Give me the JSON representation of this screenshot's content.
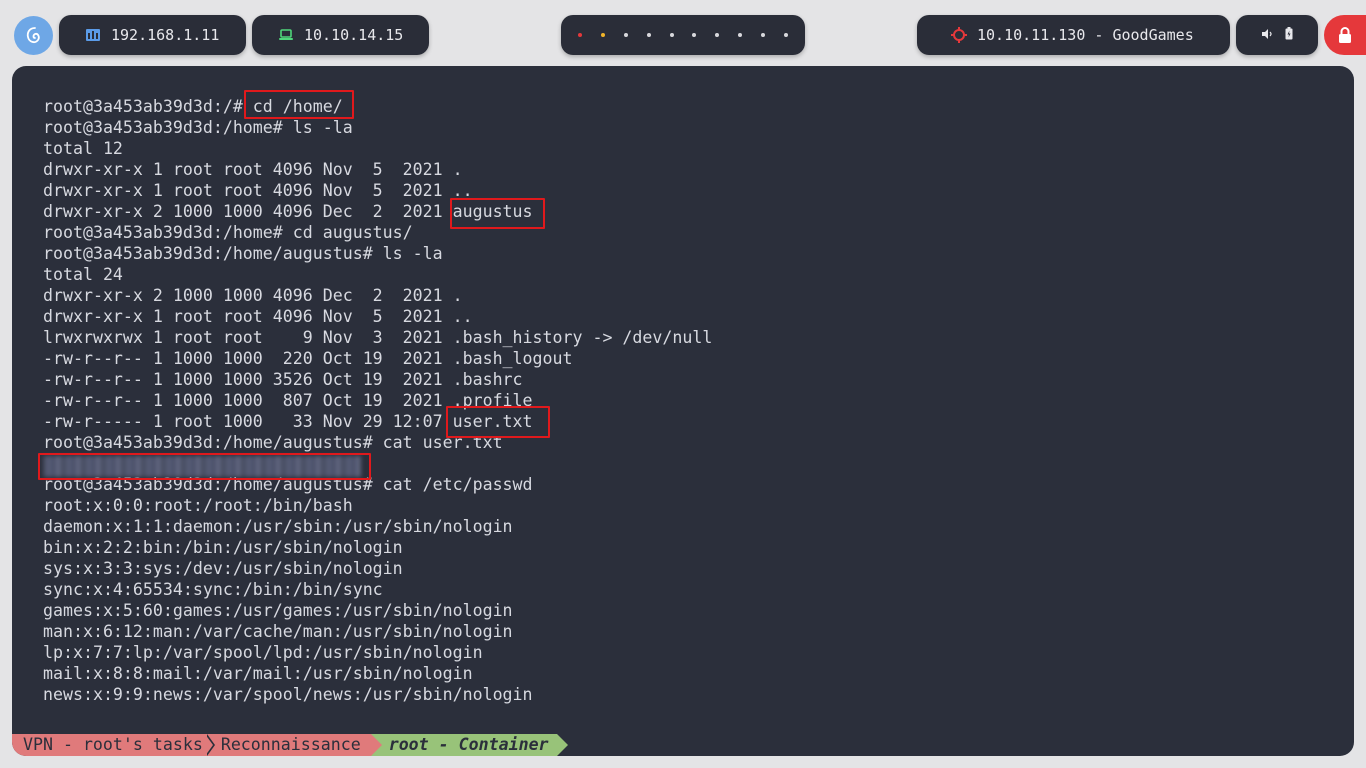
{
  "topbar": {
    "distro_icon": "debian-swirl-icon",
    "ip_local": "192.168.1.11",
    "ip_vpn": "10.10.14.15",
    "workspaces": [
      {
        "color": "#e5383b"
      },
      {
        "color": "#f0b429"
      },
      {
        "color": "#d8d8dc"
      },
      {
        "color": "#d8d8dc"
      },
      {
        "color": "#d8d8dc"
      },
      {
        "color": "#d8d8dc"
      },
      {
        "color": "#d8d8dc"
      },
      {
        "color": "#d8d8dc"
      },
      {
        "color": "#d8d8dc"
      },
      {
        "color": "#d8d8dc"
      }
    ],
    "target": "10.10.11.130 - GoodGames",
    "accent_red": "#e5383b"
  },
  "terminal": {
    "lines": [
      "root@3a453ab39d3d:/# cd /home/",
      "root@3a453ab39d3d:/home# ls -la",
      "total 12",
      "drwxr-xr-x 1 root root 4096 Nov  5  2021 .",
      "drwxr-xr-x 1 root root 4096 Nov  5  2021 ..",
      "drwxr-xr-x 2 1000 1000 4096 Dec  2  2021 augustus",
      "root@3a453ab39d3d:/home# cd augustus/",
      "root@3a453ab39d3d:/home/augustus# ls -la",
      "total 24",
      "drwxr-xr-x 2 1000 1000 4096 Dec  2  2021 .",
      "drwxr-xr-x 1 root root 4096 Nov  5  2021 ..",
      "lrwxrwxrwx 1 root root    9 Nov  3  2021 .bash_history -> /dev/null",
      "-rw-r--r-- 1 1000 1000  220 Oct 19  2021 .bash_logout",
      "-rw-r--r-- 1 1000 1000 3526 Oct 19  2021 .bashrc",
      "-rw-r--r-- 1 1000 1000  807 Oct 19  2021 .profile",
      "-rw-r----- 1 root 1000   33 Nov 29 12:07 user.txt",
      "root@3a453ab39d3d:/home/augustus# cat user.txt",
      "",
      "root@3a453ab39d3d:/home/augustus# cat /etc/passwd",
      "root:x:0:0:root:/root:/bin/bash",
      "daemon:x:1:1:daemon:/usr/sbin:/usr/sbin/nologin",
      "bin:x:2:2:bin:/bin:/usr/sbin/nologin",
      "sys:x:3:3:sys:/dev:/usr/sbin/nologin",
      "sync:x:4:65534:sync:/bin:/bin/sync",
      "games:x:5:60:games:/usr/games:/usr/sbin/nologin",
      "man:x:6:12:man:/var/cache/man:/usr/sbin/nologin",
      "lp:x:7:7:lp:/var/spool/lpd:/usr/sbin/nologin",
      "mail:x:8:8:mail:/var/mail:/usr/sbin/nologin",
      "news:x:9:9:news:/var/spool/news:/usr/sbin/nologin"
    ]
  },
  "statusline": {
    "seg1": "VPN - root's tasks",
    "seg2": "Reconnaissance",
    "seg3": "root - Container"
  }
}
